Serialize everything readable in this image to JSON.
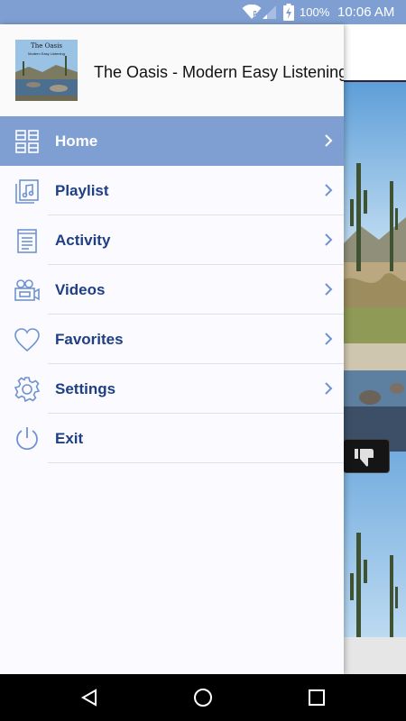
{
  "status_bar": {
    "battery": "100%",
    "time": "10:06 AM",
    "icons": [
      "wifi-icon",
      "signal-icon",
      "battery-charging-icon"
    ]
  },
  "drawer": {
    "station_name": "The Oasis - Modern Easy Listening",
    "cover_title": "The Oasis",
    "cover_subtitle": "Modern Easy Listening"
  },
  "menu": {
    "items": [
      {
        "label": "Home",
        "icon": "grid-icon",
        "active": true
      },
      {
        "label": "Playlist",
        "icon": "music-note-icon",
        "active": false
      },
      {
        "label": "Activity",
        "icon": "document-icon",
        "active": false
      },
      {
        "label": "Videos",
        "icon": "video-camera-icon",
        "active": false
      },
      {
        "label": "Favorites",
        "icon": "heart-icon",
        "active": false
      },
      {
        "label": "Settings",
        "icon": "gear-icon",
        "active": false
      },
      {
        "label": "Exit",
        "icon": "power-icon",
        "active": false
      }
    ]
  },
  "colors": {
    "accent": "#7f9fd2",
    "label": "#1f3f85",
    "icon": "#6f93d0"
  },
  "nav_bar": {
    "icons": [
      "back-icon",
      "home-circle-icon",
      "recents-icon"
    ]
  }
}
